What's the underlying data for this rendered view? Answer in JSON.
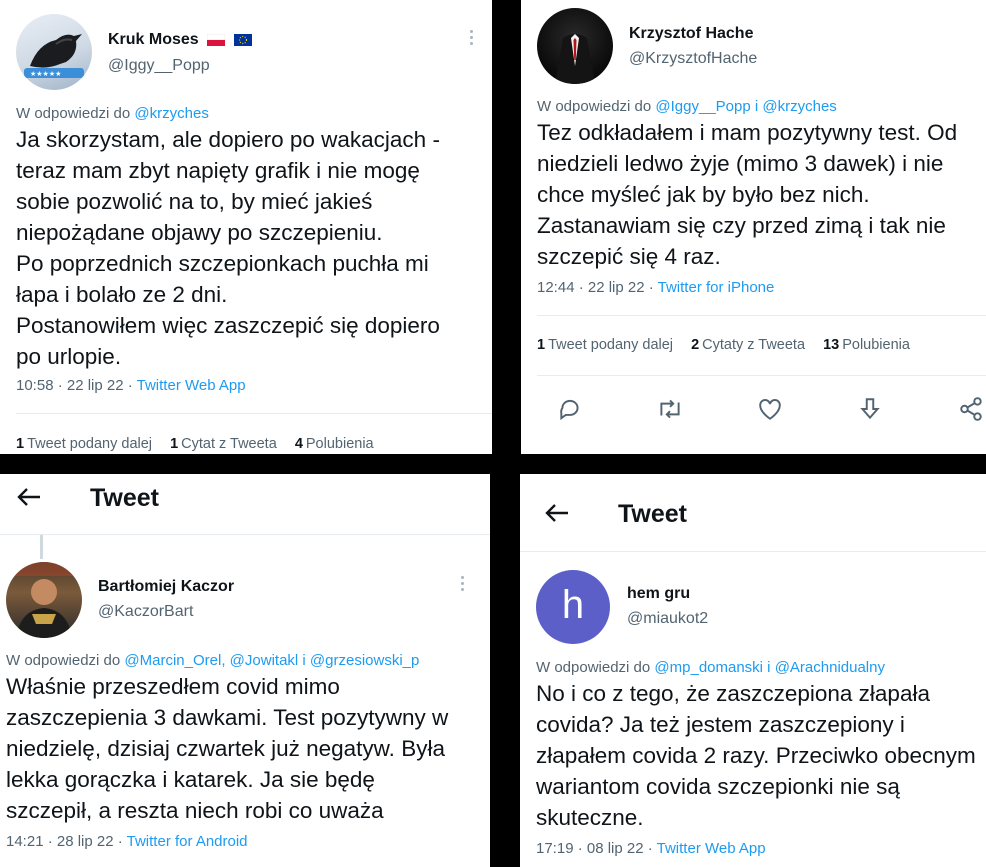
{
  "panel1": {
    "name": "Kruk Moses",
    "handle": "@Iggy__Popp",
    "reply_prefix": "W odpowiedzi do ",
    "reply_to": "@krzyches",
    "body": [
      "Ja skorzystam, ale dopiero po wakacjach -",
      "teraz mam zbyt napięty grafik i nie mogę",
      "sobie pozwolić na to, by mieć jakieś",
      "niepożądane objawy po szczepieniu.",
      "Po poprzednich szczepionkach puchła mi",
      "łapa i bolało ze 2 dni.",
      "Postanowiłem więc zaszczepić się dopiero",
      "po urlopie."
    ],
    "time": "10:58 · 22 lip 22 · ",
    "source": "Twitter Web App",
    "stats": [
      {
        "count": "1",
        "label": "Tweet podany dalej"
      },
      {
        "count": "1",
        "label": "Cytat z Tweeta"
      },
      {
        "count": "4",
        "label": "Polubienia"
      }
    ]
  },
  "panel2": {
    "name": "Krzysztof Hache",
    "handle": "@KrzysztofHache",
    "reply_prefix": "W odpowiedzi do ",
    "reply_to_1": "@Iggy__Popp",
    "reply_and": " i ",
    "reply_to_2": "@krzyches",
    "body": [
      "Tez odkładałem i mam pozytywny test. Od",
      "niedzieli ledwo żyje (mimo 3 dawek) i nie",
      "chce myśleć jak by było bez nich.",
      "Zastanawiam się czy przed zimą i tak nie",
      "szczepić się 4 raz."
    ],
    "time": "12:44 · 22 lip 22 · ",
    "source": "Twitter for iPhone",
    "stats": [
      {
        "count": "1",
        "label": "Tweet podany dalej"
      },
      {
        "count": "2",
        "label": "Cytaty z Tweeta"
      },
      {
        "count": "13",
        "label": "Polubienia"
      }
    ]
  },
  "panel3": {
    "header_title": "Tweet",
    "name": "Bartłomiej Kaczor",
    "handle": "@KaczorBart",
    "reply_prefix": "W odpowiedzi do ",
    "reply_to_1": "@Marcin_Orel",
    "reply_sep": ", ",
    "reply_to_2": "@Jowitakl",
    "reply_and": " i ",
    "reply_to_3": "@grzesiowski_p",
    "body": [
      "Właśnie przeszedłem covid mimo",
      "zaszczepienia 3 dawkami. Test pozytywny w",
      "niedzielę, dzisiaj czwartek już negatyw. Była",
      "lekka gorączka i katarek. Ja sie będę",
      "szczepił, a reszta niech robi co uważa"
    ],
    "time": "14:21 · 28 lip 22 · ",
    "source": "Twitter for Android"
  },
  "panel4": {
    "header_title": "Tweet",
    "avatar_letter": "h",
    "name": "hem gru",
    "handle": "@miaukot2",
    "reply_prefix": "W odpowiedzi do ",
    "reply_to_1": "@mp_domanski",
    "reply_and": " i ",
    "reply_to_2": "@Arachnidualny",
    "body": [
      "No i co z tego, że zaszczepiona złapała",
      "covida? Ja też jestem zaszczepiony i",
      "złapałem covida 2 razy. Przeciwko obecnym",
      "wariantom covida szczepionki nie są",
      "skuteczne."
    ],
    "time": "17:19 · 08 lip 22 · ",
    "source": "Twitter Web App"
  },
  "colors": {
    "link": "#1d9bf0",
    "muted": "#536471",
    "text": "#0f1419",
    "avatar_h": "#5b5fc7"
  },
  "icons": [
    "reply-icon",
    "retweet-icon",
    "like-icon",
    "bookmark-icon",
    "share-icon",
    "back-arrow-icon",
    "more-icon"
  ]
}
